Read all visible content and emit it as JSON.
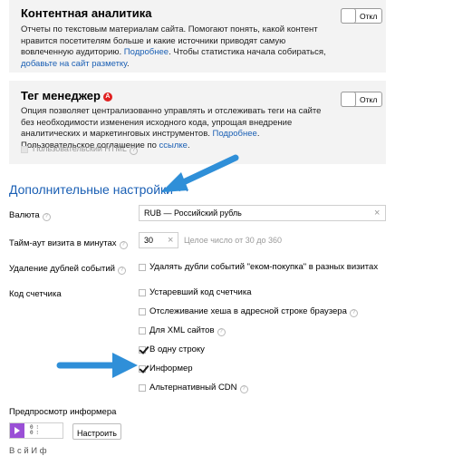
{
  "content_analytics": {
    "title": "Контентная аналитика",
    "desc_text": "Отчеты по текстовым материалам сайта. Помогают понять, какой контент нравится посетителям больше и какие источники приводят самую вовлеченную аудиторию.",
    "desc_link1": "Подробнее",
    "desc_mid": ". Чтобы статистика начала собираться, ",
    "desc_link2": "добавьте на сайт разметку",
    "desc_end": ".",
    "toggle_label": "Откл"
  },
  "tag_manager": {
    "title": "Тег менеджер",
    "badge": "A",
    "desc_text": "Опция позволяет централизованно управлять и отслеживать теги на сайте без необходимости изменения исходного кода, упрощая внедрение аналитических и маркетинговых инструментов.",
    "desc_link1": "Подробнее",
    "desc_mid": ". Пользовательское соглашение по ",
    "desc_link2": "ссылке",
    "desc_end": ".",
    "toggle_label": "Откл",
    "custom_html_label": "Пользовательский HTML",
    "custom_html_checked": false
  },
  "additional_settings": {
    "title": "Дополнительные настройки",
    "currency": {
      "label": "Валюта",
      "value": "RUB — Российский рубль"
    },
    "timeout": {
      "label": "Тайм-аут визита в минутах",
      "value": "30",
      "hint": "Целое число от 30 до 360"
    },
    "dedup": {
      "label": "Удаление дублей событий",
      "option": "Удалять дубли событий \"еком-покупка\" в разных визитах",
      "checked": false
    },
    "counter_code": {
      "label": "Код счетчика",
      "options": [
        {
          "label": "Устаревший код счетчика",
          "checked": false
        },
        {
          "label": "Отслеживание хеша в адресной строке браузера",
          "checked": false
        },
        {
          "label": "Для XML сайтов",
          "checked": false
        },
        {
          "label": "В одну строку",
          "checked": true
        },
        {
          "label": "Информер",
          "checked": true
        },
        {
          "label": "Альтернативный CDN",
          "checked": false
        }
      ]
    }
  },
  "informer_preview": {
    "label": "Предпросмотр информера",
    "configure_button": "Настроить",
    "footer_text": "В  с  й  И  ф"
  },
  "colors": {
    "link": "#1a5fb4",
    "card_bg": "#f3f3f3",
    "arrow": "#2f8fd8",
    "badge": "#e02020"
  }
}
